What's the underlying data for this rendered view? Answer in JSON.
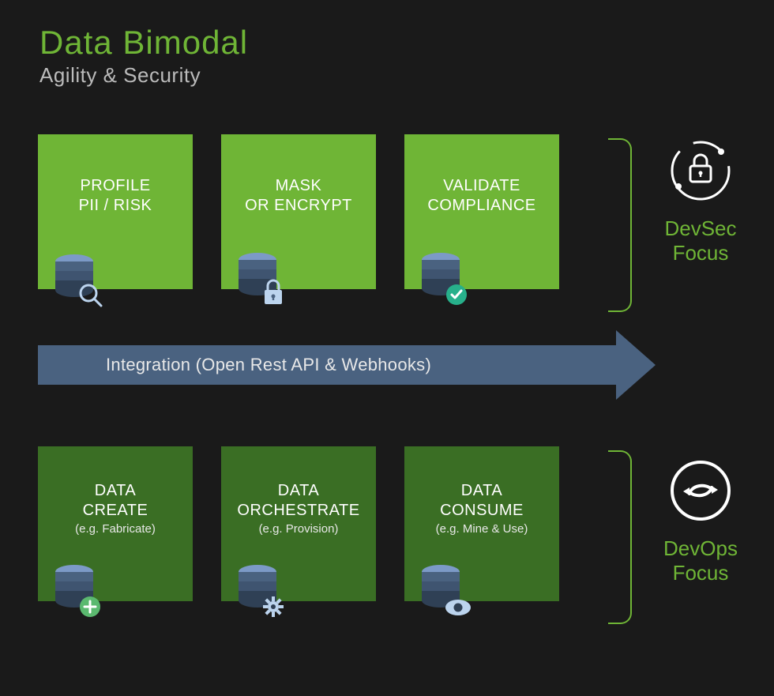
{
  "header": {
    "title": "Data Bimodal",
    "subtitle": "Agility & Security"
  },
  "rows": {
    "top": {
      "cards": [
        {
          "line1": "PROFILE",
          "line2": "PII / RISK",
          "icon": "database-search-icon"
        },
        {
          "line1": "MASK",
          "line2": "OR ENCRYPT",
          "icon": "database-lock-icon"
        },
        {
          "line1": "VALIDATE",
          "line2": "COMPLIANCE",
          "icon": "database-check-icon"
        }
      ],
      "focus": {
        "line1": "DevSec",
        "line2": "Focus",
        "icon": "security-orbit-icon"
      }
    },
    "bottom": {
      "cards": [
        {
          "line1": "DATA",
          "line2": "CREATE",
          "sub": "(e.g. Fabricate)",
          "icon": "database-plus-icon"
        },
        {
          "line1": "DATA",
          "line2": "ORCHESTRATE",
          "sub": "(e.g. Provision)",
          "icon": "database-gear-icon"
        },
        {
          "line1": "DATA",
          "line2": "CONSUME",
          "sub": "(e.g. Mine & Use)",
          "icon": "database-eye-icon"
        }
      ],
      "focus": {
        "line1": "DevOps",
        "line2": "Focus",
        "icon": "cycle-icon"
      }
    }
  },
  "arrow": {
    "label": "Integration (Open Rest API & Webhooks)"
  },
  "colors": {
    "accent": "#6fb536",
    "card_light": "#6fb536",
    "card_dark": "#3a6e24",
    "arrow": "#4a6280",
    "db_top": "#7c9ac7",
    "db_body": "#4a6280"
  }
}
